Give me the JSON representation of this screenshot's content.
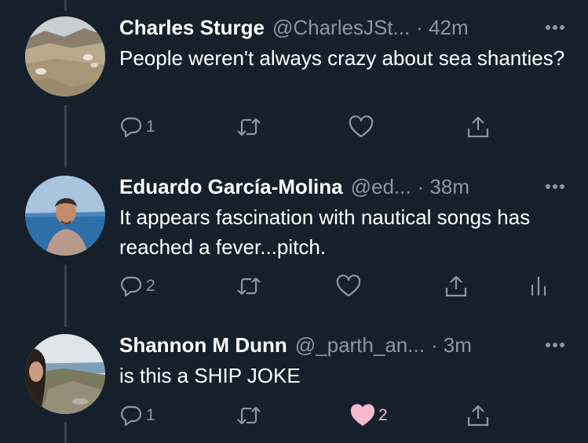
{
  "tweets": [
    {
      "name": "Charles Sturge",
      "handle": "@CharlesJSt...",
      "time": "· 42m",
      "text": "People weren't always crazy about sea shanties?",
      "replies": "1",
      "likes": "",
      "avatar_scene": "rocky-hills-with-goats"
    },
    {
      "name": "Eduardo García-Molina",
      "handle": "@ed...",
      "time": "· 38m",
      "text": "It appears fascination with nautical songs has reached a fever...pitch.",
      "replies": "2",
      "likes": "",
      "avatar_scene": "man-by-the-sea"
    },
    {
      "name": "Shannon M Dunn",
      "handle": "@_parth_an...",
      "time": "· 3m",
      "text": "is this a SHIP JOKE",
      "replies": "1",
      "likes": "2",
      "avatar_scene": "woman-on-coastal-hill"
    }
  ],
  "colors": {
    "background": "#15202b",
    "secondary_text": "#8899a6",
    "thread_line": "#38444d",
    "like_active": "#e0245e",
    "like_fill_muted": "#f4b9cc"
  },
  "icons": [
    "reply-icon",
    "retweet-icon",
    "like-icon",
    "share-icon",
    "analytics-icon",
    "more-icon"
  ]
}
